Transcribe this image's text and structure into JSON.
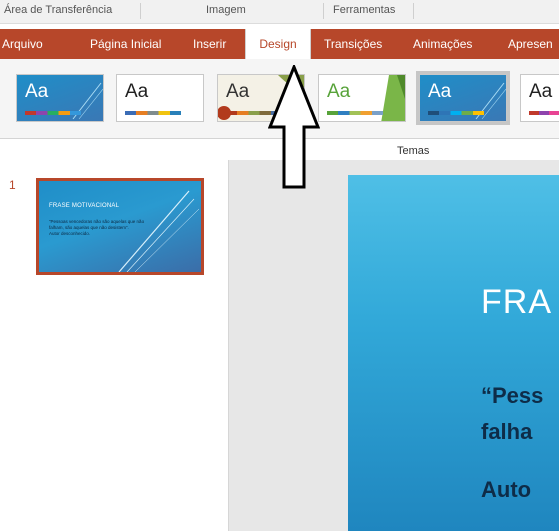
{
  "ribbon_groups": {
    "clipboard": "Área de Transferência",
    "image": "Imagem",
    "tools": "Ferramentas"
  },
  "tabs": [
    {
      "label": "Arquivo"
    },
    {
      "label": "Página Inicial"
    },
    {
      "label": "Inserir"
    },
    {
      "label": "Design"
    },
    {
      "label": "Transições"
    },
    {
      "label": "Animações"
    },
    {
      "label": "Apresen"
    }
  ],
  "active_tab": "Design",
  "themes": {
    "group_label": "Temas",
    "items": [
      {
        "sample": "Aa"
      },
      {
        "sample": "Aa"
      },
      {
        "sample": "Aa"
      },
      {
        "sample": "Aa"
      },
      {
        "sample": "Aa"
      },
      {
        "sample": "Aa"
      }
    ],
    "selected_index": 4
  },
  "slides": [
    {
      "number": "1",
      "title": "FRASE MOTIVACIONAL",
      "quote": "“Pessoas vencedoras não são aquelas que não falham, são aquelas que não desistem”.",
      "author": "Autor desconhecido."
    }
  ],
  "main_slide": {
    "title": "FRA",
    "line1": "“Pess",
    "line2": "falha",
    "line3": "Auto"
  },
  "colors": {
    "accent": "#b7472a",
    "slide_blue": "#2a9ad0"
  }
}
